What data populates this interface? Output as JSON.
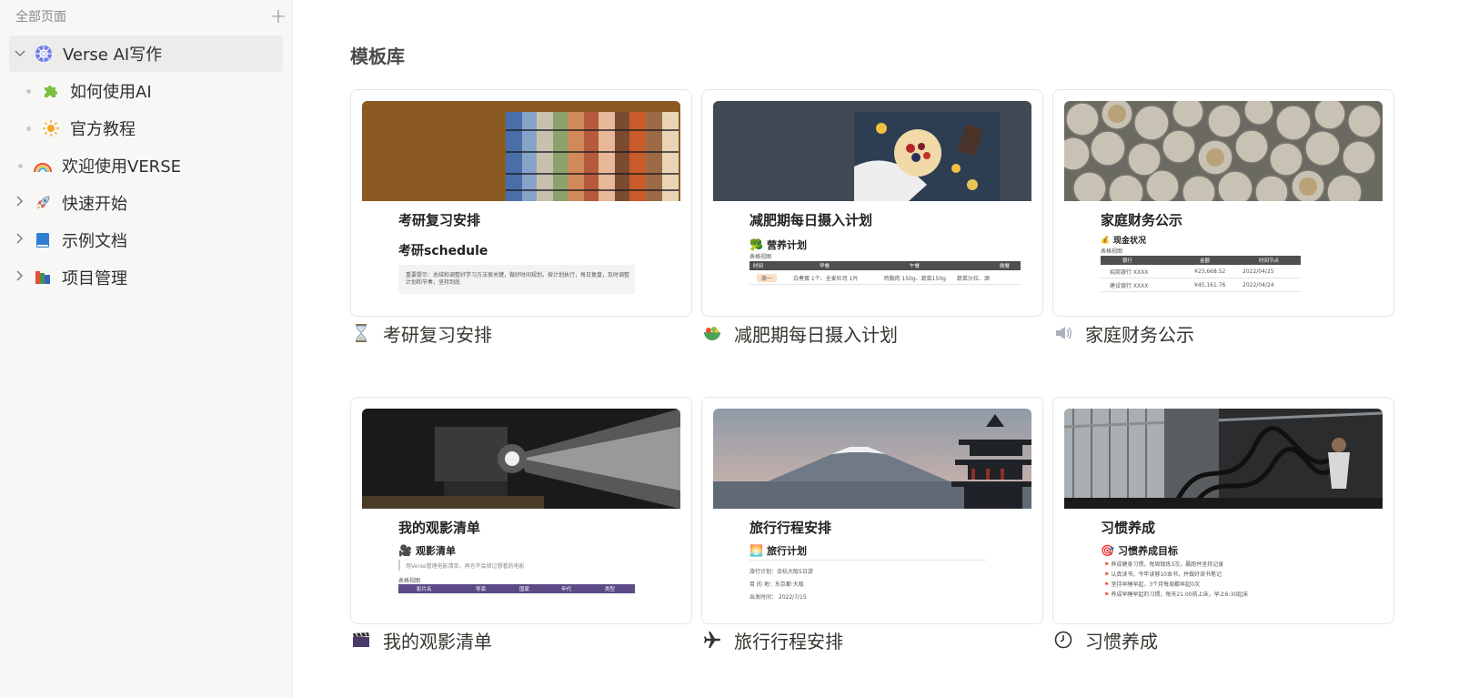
{
  "sidebar": {
    "header": "全部页面",
    "add_label": "+",
    "items": [
      {
        "label": "Verse AI写作",
        "icon": "verse-logo-icon",
        "arrow": "chevron-down",
        "active": true
      },
      {
        "label": "如何使用AI",
        "icon": "puzzle-icon"
      },
      {
        "label": "官方教程",
        "icon": "sun-icon"
      },
      {
        "label": "欢迎使用VERSE",
        "icon": "rainbow-icon"
      },
      {
        "label": "快速开始",
        "icon": "rocket-icon",
        "arrow": "chevron-right"
      },
      {
        "label": "示例文档",
        "icon": "blue-book-icon",
        "arrow": "chevron-right"
      },
      {
        "label": "项目管理",
        "icon": "books-icon",
        "arrow": "chevron-right"
      }
    ]
  },
  "main": {
    "title": "模板库",
    "templates": [
      {
        "title": "考研复习安排",
        "icon": "hourglass-icon",
        "preview": {
          "h1": "考研复习安排",
          "h2": "考研schedule",
          "note": "重要提示：总结和调整好学习方法很关键，做好时间规划，按计划执行，每日复盘，及时调整计划和节奏，坚持到底"
        }
      },
      {
        "title": "减肥期每日摄入计划",
        "icon": "salad-icon",
        "preview": {
          "h1": "减肥期每日摄入计划",
          "h2": "营养计划",
          "view": "表格视图",
          "columns": [
            "时间",
            "早餐",
            "午餐",
            "晚餐"
          ],
          "row": [
            "周一",
            "白煮蛋 1个、全麦吐司 1片",
            "鸡胸肉 150g、蔬菜150g",
            "蔬菜沙拉、酒"
          ]
        }
      },
      {
        "title": "家庭财务公示",
        "icon": "speaker-icon",
        "preview": {
          "h1": "家庭财务公示",
          "h2": "现金状况",
          "view": "表格视图",
          "columns": [
            "银行",
            "金额",
            "时间节点"
          ],
          "rows": [
            [
              "招商银行 XXXX",
              "¥23,668.52",
              "2022/04/25"
            ],
            [
              "建设银行 XXXX",
              "¥45,161.76",
              "2022/04/24"
            ]
          ]
        }
      },
      {
        "title": "我的观影清单",
        "icon": "clapper-icon",
        "preview": {
          "h1": "我的观影清单",
          "h2": "观影清单",
          "note": "用Verse管理电影清单，再也不会错过想看的电影",
          "view": "表格视图",
          "columns": [
            "影片名",
            "导演",
            "国家",
            "年代",
            "类型"
          ]
        }
      },
      {
        "title": "旅行行程安排",
        "icon": "airplane-icon",
        "preview": {
          "h1": "旅行行程安排",
          "h2": "旅行计划",
          "lines": [
            "旅行计划：余杭大阪5日游",
            "目  的  地：东京都·大阪",
            "出发时间：   2022/7/15"
          ]
        }
      },
      {
        "title": "习惯养成",
        "icon": "clock-icon",
        "preview": {
          "h1": "习惯养成",
          "h2": "习惯养成目标",
          "lines": [
            "养成健身习惯，每周锻炼3次，晨跑并坚持记录",
            "认真读书，今年读够10本书，并做好读书笔记",
            "坚持早睡早起，3个月每周都早起0次",
            "养成早睡早起的习惯，每天21:00前上床，早上6:30起床"
          ]
        }
      }
    ]
  },
  "colors": {
    "sidebar_bg": "#f7f7f5",
    "active_bg": "#ececeb",
    "table_header": "#4f4f4f",
    "movie_table": "#5b4a86"
  }
}
